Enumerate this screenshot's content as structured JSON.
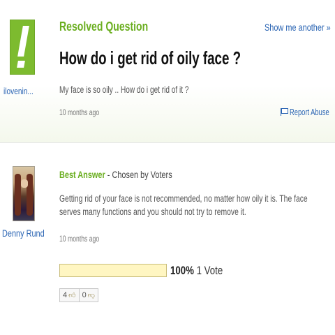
{
  "question": {
    "status_label": "Resolved Question",
    "show_another_label": "Show me another »",
    "title": "How do i get rid of oily face ?",
    "body": "My face is so oily .. How do i get rid of it ?",
    "time": "10 months ago",
    "report_label": "Report Abuse",
    "asker": {
      "name": "ilovenin...",
      "avatar_icon": "exclamation-icon",
      "avatar_color": "#7dbb2f"
    }
  },
  "answer": {
    "badge_label": "Best Answer",
    "chosen_by": "- Chosen by Voters",
    "text": "Getting rid of your face is not recommended, no matter how oily it is. The face serves many functions and you should not try to remove it.",
    "time": "10 months ago",
    "answerer": {
      "name": "Denny Rund"
    },
    "vote": {
      "percent_label": "100%",
      "votes_label": "1 Vote",
      "fill_fraction": 1.0
    },
    "rating": {
      "thumbs_up_count": "4",
      "thumbs_down_count": "0",
      "thumbs_up_icon": "thumbs-up-icon",
      "thumbs_down_icon": "thumbs-down-icon"
    }
  },
  "colors": {
    "accent_green": "#6aae1f",
    "link_blue": "#2a64b3",
    "vote_bar": "#fdf3b8"
  }
}
